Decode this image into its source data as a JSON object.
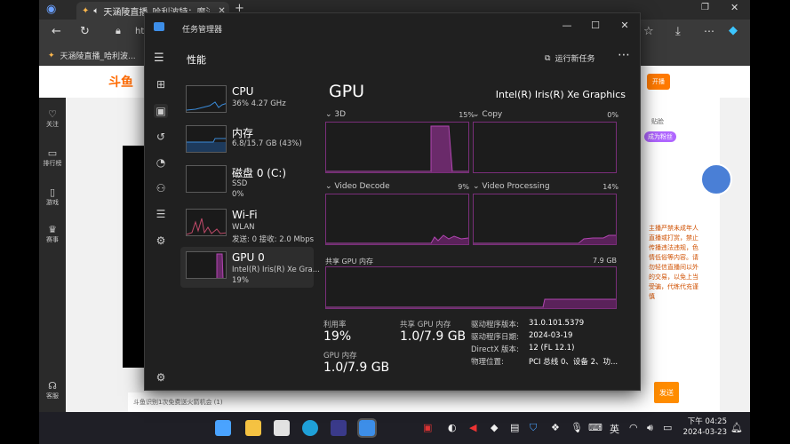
{
  "browser": {
    "tab_title": "天涵陵直播_哈利波特：魔法",
    "bookmark": "天涵陵直播_哈利波...",
    "url_partial": "htt"
  },
  "web": {
    "logo": "斗鱼",
    "open_btn": "开播",
    "leftnav": [
      "关注",
      "排行榜",
      "游戏",
      "赛事",
      "客服"
    ],
    "notice": "主播严禁未成年人直播或打赏，禁止传播违法违规，色情低俗等内容。请勿轻信直播间以外的交易，以免上当受骗，代练代充谨慎",
    "send": "发送",
    "bottom_text": "斗鱼识别1次免费送火箭机会 (1)",
    "right_items": [
      "贴脸",
      "成为粉丝"
    ]
  },
  "taskmanager": {
    "window_title": "任务管理器",
    "page_title": "性能",
    "run_new_task": "运行新任务",
    "items": [
      {
        "name": "CPU",
        "line1": "36% 4.27 GHz",
        "line2": ""
      },
      {
        "name": "内存",
        "line1": "6.8/15.7 GB (43%)",
        "line2": ""
      },
      {
        "name": "磁盘 0 (C:)",
        "line1": "SSD",
        "line2": "0%"
      },
      {
        "name": "Wi-Fi",
        "line1": "WLAN",
        "line2": "发送: 0 接收: 2.0 Mbps"
      },
      {
        "name": "GPU 0",
        "line1": "Intel(R) Iris(R) Xe Gra...",
        "line2": "19%"
      }
    ],
    "gpu": {
      "title": "GPU",
      "model": "Intel(R) Iris(R) Xe Graphics",
      "engines": [
        {
          "label": "3D",
          "pct": "15%",
          "level": 0.15
        },
        {
          "label": "Copy",
          "pct": "0%",
          "level": 0
        },
        {
          "label": "Video Decode",
          "pct": "9%",
          "level": 0.09
        },
        {
          "label": "Video Processing",
          "pct": "14%",
          "level": 0.14
        }
      ],
      "shared_label": "共享 GPU 内存",
      "shared_max": "7.9 GB",
      "utilization_label": "利用率",
      "utilization_value": "19%",
      "shared_mem_label": "共享 GPU 内存",
      "shared_mem_value": "1.0/7.9 GB",
      "gpu_mem_label": "GPU 内存",
      "gpu_mem_value": "1.0/7.9 GB",
      "driver_version_label": "驱动程序版本:",
      "driver_version": "31.0.101.5379",
      "driver_date_label": "驱动程序日期:",
      "driver_date": "2024-03-19",
      "directx_label": "DirectX 版本:",
      "directx": "12 (FL 12.1)",
      "location_label": "物理位置:",
      "location": "PCI 总线 0、设备 2、功..."
    }
  },
  "taskbar": {
    "ime": "英",
    "time": "下午 04:25",
    "date": "2024-03-23"
  }
}
